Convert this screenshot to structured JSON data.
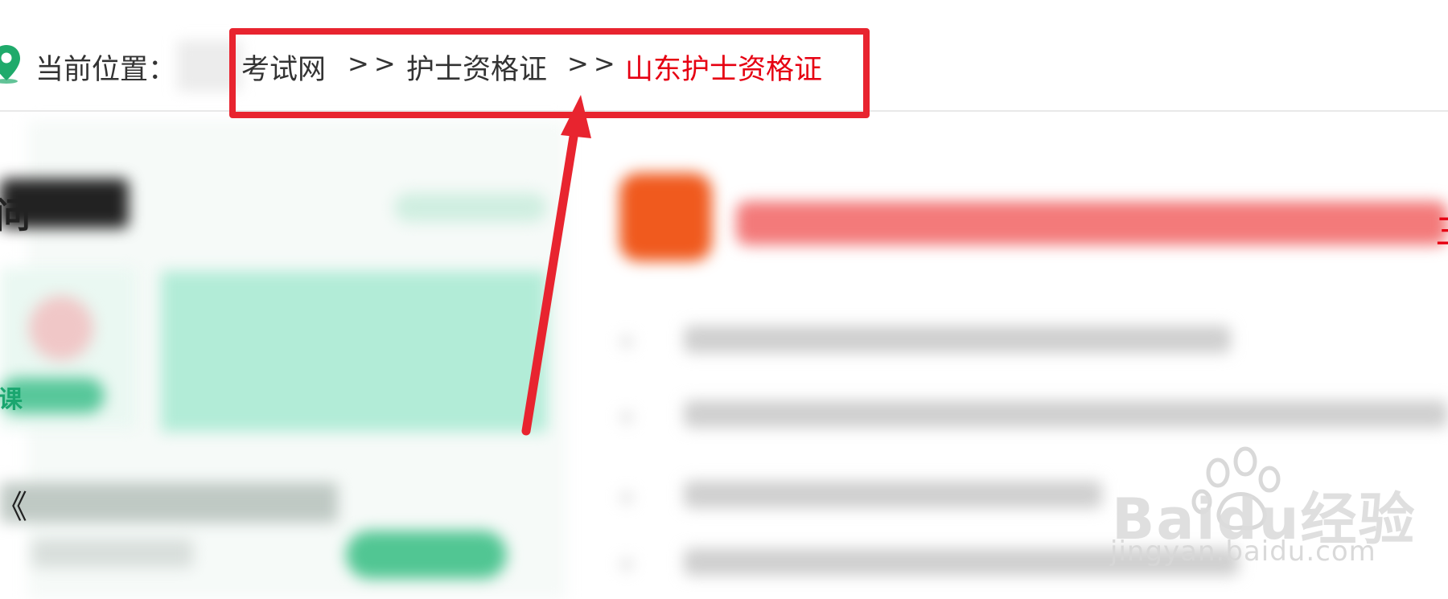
{
  "breadcrumb": {
    "label": "当前位置：",
    "items": [
      {
        "text": "考试网",
        "current": false
      },
      {
        "text": "护士资格证",
        "current": false
      },
      {
        "text": "山东护士资格证",
        "current": true
      }
    ],
    "separator": ">>"
  },
  "annotation": {
    "box_color": "#e8242f",
    "arrow_color": "#e8242f"
  },
  "fragments": {
    "left_top": "问",
    "left_green": "课",
    "left_book": "《",
    "right_red": "三"
  },
  "watermark": {
    "brand": "Baidu经验",
    "url": "jingyan.baidu.com"
  },
  "colors": {
    "accent_red": "#e60012",
    "text": "#333333",
    "brand_green": "#51c693"
  },
  "icons": {
    "location": "location-pin-icon",
    "watermark": "baidu-paw-icon"
  }
}
